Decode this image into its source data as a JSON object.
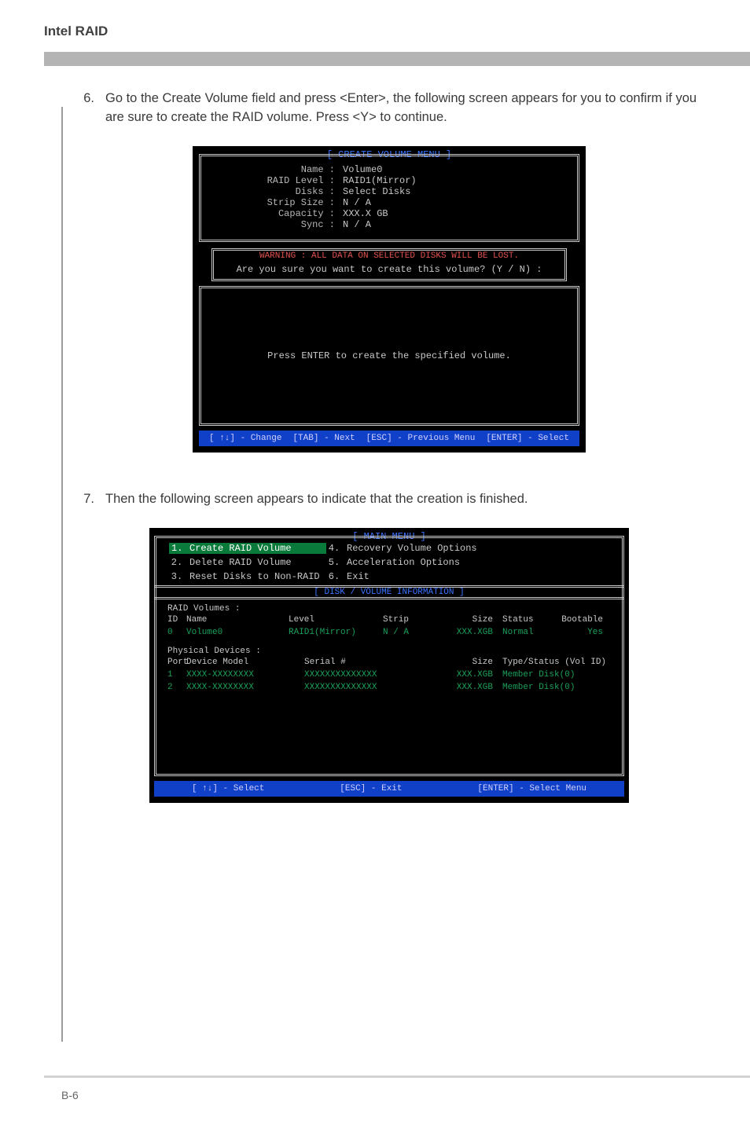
{
  "header": {
    "title": "Intel RAID"
  },
  "footer": {
    "page": "B-6"
  },
  "steps": {
    "s6": {
      "num": "6.",
      "text": "Go to the Create Volume field and press <Enter>, the following screen appears for you to confirm if you are sure to create the RAID volume. Press <Y> to continue."
    },
    "s7": {
      "num": "7.",
      "text": "Then the following screen appears to indicate that the creation is finished."
    }
  },
  "bios1": {
    "title": "[  CREATE VOLUME MENU  ]",
    "fields": {
      "name_k": "Name :",
      "name_v": "Volume0",
      "raid_k": "RAID Level :",
      "raid_v": "RAID1(Mirror)",
      "disks_k": "Disks :",
      "disks_v": "Select Disks",
      "strip_k": "Strip Size :",
      "strip_v": "N / A",
      "cap_k": "Capacity :",
      "cap_v": "XXX.X  GB",
      "sync_k": "Sync :",
      "sync_v": "N / A"
    },
    "warn": "WARNING : ALL DATA ON SELECTED DISKS WILL BE LOST.",
    "question": "Are  you  sure  you  want  to  create  this  volume?  (Y / N)  :",
    "mid": "Press  ENTER  to  create  the  specified  volume.",
    "foot": {
      "change": "[ ↑↓] - Change",
      "tab": "[TAB] - Next",
      "esc": "[ESC] - Previous Menu",
      "enter": "[ENTER] - Select"
    }
  },
  "bios2": {
    "title": "[   MAIN  MENU   ]",
    "menu": {
      "n1": "1.",
      "l1": "Create  RAID  Volume",
      "n2": "2.",
      "l2": "Delete  RAID  Volume",
      "n3": "3.",
      "l3": "Reset Disks to Non-RAID",
      "n4": "4.",
      "l4": "Recovery Volume  Options",
      "n5": "5.",
      "l5": "Acceleration Options",
      "n6": "6.",
      "l6": "Exit"
    },
    "divtitle": "[   DISK / VOLUME INFORMATION   ]",
    "vol_section": "RAID  Volumes :",
    "vol_hdr": {
      "id": "ID",
      "name": "Name",
      "level": "Level",
      "strip": "Strip",
      "size": "Size",
      "status": "Status",
      "boot": "Bootable"
    },
    "vol_row": {
      "id": "0",
      "name": "Volume0",
      "level": "RAID1(Mirror)",
      "strip": "N / A",
      "size": "XXX.XGB",
      "status": "Normal",
      "boot": "Yes"
    },
    "phy_section": "Physical  Devices :",
    "phy_hdr": {
      "port": "Port",
      "model": "Device  Model",
      "serial": "Serial  #",
      "size": "Size",
      "type": "Type/Status (Vol  ID)"
    },
    "phy1": {
      "port": "1",
      "model": "XXXX-XXXXXXXX",
      "serial": "XXXXXXXXXXXXXX",
      "size": "XXX.XGB",
      "type": "Member  Disk(0)"
    },
    "phy2": {
      "port": "2",
      "model": "XXXX-XXXXXXXX",
      "serial": "XXXXXXXXXXXXXX",
      "size": "XXX.XGB",
      "type": "Member  Disk(0)"
    },
    "foot": {
      "select": "[ ↑↓] - Select",
      "esc": "[ESC] - Exit",
      "enter": "[ENTER] - Select Menu"
    }
  }
}
